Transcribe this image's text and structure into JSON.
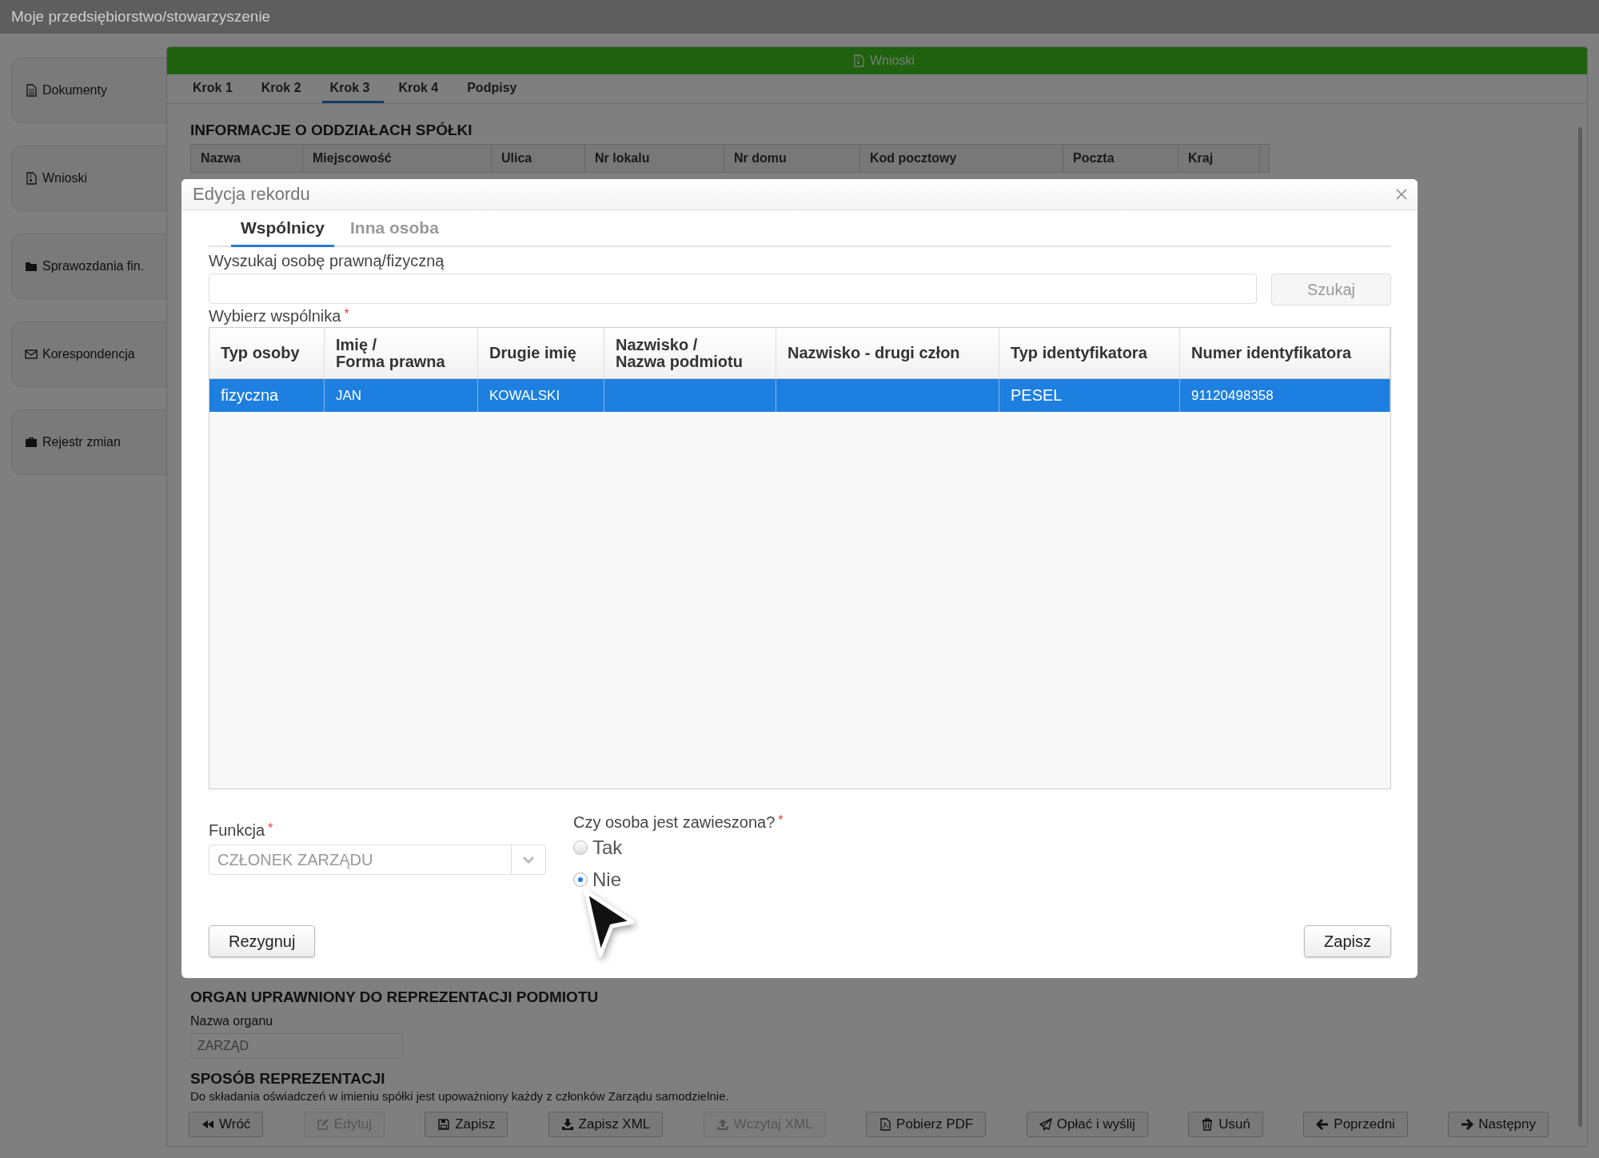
{
  "app_bar": {
    "title": "Moje przedsiębiorstwo/stowarzyszenie"
  },
  "sidebar": {
    "items": [
      {
        "label": "Dokumenty",
        "selected": false
      },
      {
        "label": "Wnioski",
        "selected": false
      },
      {
        "label": "Sprawozdania fin.",
        "selected": false
      },
      {
        "label": "Korespondencja",
        "selected": false
      },
      {
        "label": "Rejestr zmian",
        "selected": false
      }
    ]
  },
  "panel": {
    "title": "Wnioski",
    "steps": [
      {
        "label": "Krok 1",
        "selected": false
      },
      {
        "label": "Krok 2",
        "selected": false
      },
      {
        "label": "Krok 3",
        "selected": true
      },
      {
        "label": "Krok 4",
        "selected": false
      },
      {
        "label": "Podpisy",
        "selected": false
      }
    ],
    "branches_section": {
      "heading": "INFORMACJE O ODDZIAŁACH SPÓŁKI",
      "columns": [
        "Nazwa",
        "Miejscowość",
        "Ulica",
        "Nr lokalu",
        "Nr domu",
        "Kod pocztowy",
        "Poczta",
        "Kraj"
      ]
    },
    "organ_section": {
      "heading": "ORGAN UPRAWNIONY DO REPREZENTACJI PODMIOTU",
      "field_label": "Nazwa organu",
      "field_value": "ZARZĄD"
    },
    "representation_section": {
      "heading": "SPOSÓB REPREZENTACJI",
      "text": "Do składania oświadczeń w imieniu spółki jest upoważniony każdy z członków Zarządu samodzielnie."
    },
    "actions": [
      {
        "label": "Wróć",
        "disabled": false
      },
      {
        "label": "Edytuj",
        "disabled": true
      },
      {
        "label": "Zapisz",
        "disabled": false
      },
      {
        "label": "Zapisz XML",
        "disabled": false
      },
      {
        "label": "Wczytaj XML",
        "disabled": true
      },
      {
        "label": "Pobierz PDF",
        "disabled": false
      },
      {
        "label": "Opłać i wyślij",
        "disabled": false
      },
      {
        "label": "Usuń",
        "disabled": false
      },
      {
        "label": "Poprzedni",
        "disabled": false
      },
      {
        "label": "Następny",
        "disabled": false
      }
    ]
  },
  "dialog": {
    "title": "Edycja rekordu",
    "tabs": [
      {
        "label": "Wspólnicy",
        "selected": true
      },
      {
        "label": "Inna osoba",
        "selected": false
      }
    ],
    "search": {
      "label": "Wyszukaj osobę prawną/fizyczną",
      "button": "Szukaj",
      "button_disabled": true
    },
    "partners": {
      "label": "Wybierz wspólnika",
      "required_mark": "*",
      "columns": [
        "Typ osoby",
        "Imię /\nForma prawna",
        "Drugie imię",
        "Nazwisko /\nNazwa podmiotu",
        "Nazwisko - drugi człon",
        "Typ identyfikatora",
        "Numer identyfikatora"
      ],
      "rows": [
        {
          "cells": [
            "fizyczna",
            "JAN",
            "KOWALSKI",
            "",
            "",
            "PESEL",
            "91120498358"
          ],
          "selected": true
        }
      ]
    },
    "function": {
      "label": "Funkcja",
      "required_mark": "*",
      "value": "CZŁONEK ZARZĄDU",
      "disabled": true
    },
    "suspended": {
      "question": "Czy osoba jest zawieszona?",
      "required_mark": "*",
      "options": [
        {
          "label": "Tak",
          "selected": false
        },
        {
          "label": "Nie",
          "selected": true
        }
      ]
    },
    "cancel_button": "Rezygnuj",
    "save_button": "Zapisz"
  }
}
